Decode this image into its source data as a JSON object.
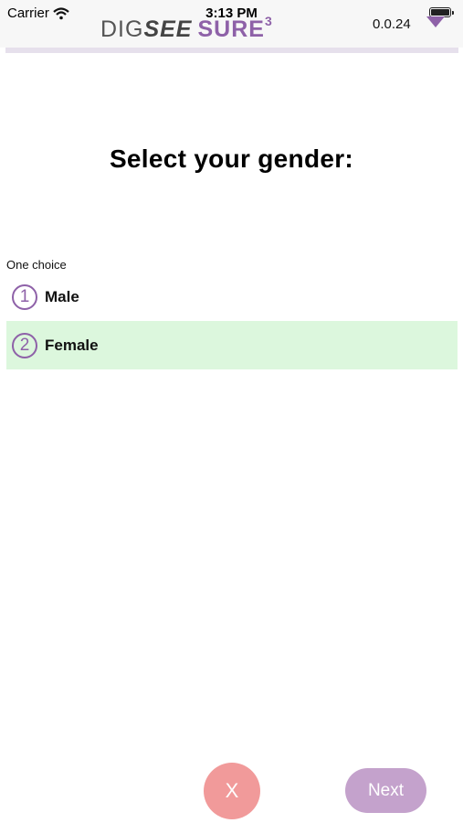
{
  "status_bar": {
    "carrier": "Carrier",
    "time": "3:13 PM"
  },
  "header": {
    "logo_part1": "DIG",
    "logo_part2": "SEE",
    "logo_part3": "SURE",
    "logo_superscript": "3",
    "version": "0.0.24"
  },
  "question": {
    "title": "Select your gender:",
    "hint": "One choice",
    "options": [
      {
        "number": "1",
        "label": "Male",
        "selected": false
      },
      {
        "number": "2",
        "label": "Female",
        "selected": true
      }
    ]
  },
  "buttons": {
    "cancel_label": "X",
    "next_label": "Next"
  },
  "colors": {
    "accent": "#8e61a8",
    "selected_bg": "#dcf7dd",
    "cancel_bg": "#f19a9a",
    "next_bg": "#c4a2cc"
  }
}
